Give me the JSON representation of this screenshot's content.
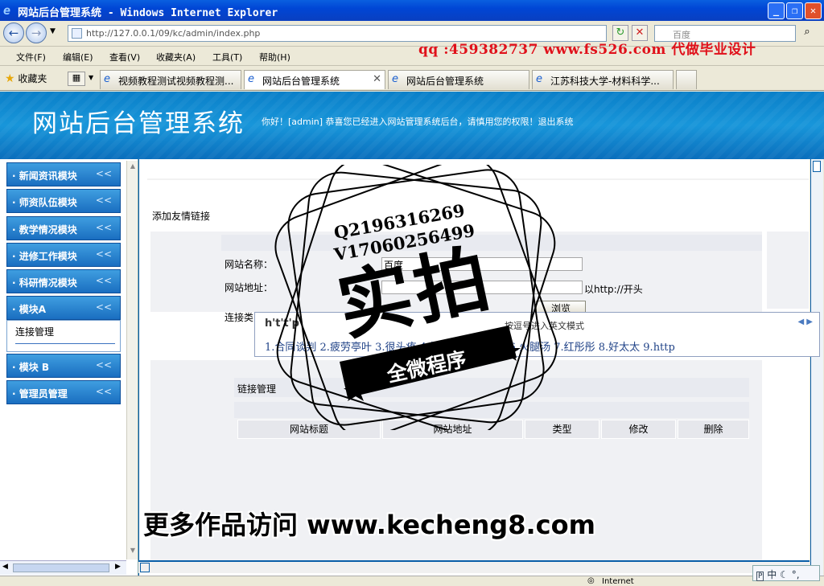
{
  "window": {
    "title": "网站后台管理系统 - Windows Internet Explorer",
    "minimize": "_",
    "maximize": "❐",
    "close": "✕"
  },
  "address_bar": {
    "url": "http://127.0.0.1/09/kc/admin/index.php",
    "search_placeholder": "百度",
    "promo": "qq :459382737 www.fs526.com 代做毕业设计"
  },
  "menu": [
    "文件(F)",
    "编辑(E)",
    "查看(V)",
    "收藏夹(A)",
    "工具(T)",
    "帮助(H)"
  ],
  "favorites_label": "收藏夹",
  "tabs": [
    {
      "label": "视频教程测试视频教程测...",
      "active": false
    },
    {
      "label": "网站后台管理系统",
      "active": true
    },
    {
      "label": "网站后台管理系统",
      "active": false
    },
    {
      "label": "江苏科技大学-材料科学...",
      "active": false
    }
  ],
  "header": {
    "site_title": "网站后台管理系统",
    "welcome": "你好！[admin] 恭喜您已经进入网站管理系统后台，请慎用您的权限！退出系统"
  },
  "sidebar": {
    "modules": [
      "· 新闻资讯模块",
      "· 师资队伍模块",
      "· 教学情况模块",
      "· 进修工作模块",
      "· 科研情况模块",
      "· 模块A",
      "· 模块 B",
      "· 管理员管理"
    ],
    "sub_item": "连接管理",
    "chevron": "<<"
  },
  "form": {
    "section_title": "添加友情链接",
    "name_label": "网站名称：",
    "name_value": "百度",
    "url_label": "网站地址：",
    "url_value": "",
    "url_hint": "以http://开头",
    "type_label": "连接类",
    "browse_button": "浏览"
  },
  "links_table": {
    "title": "链接管理",
    "headers": [
      "网站标题",
      "网站地址",
      "类型",
      "修改",
      "删除"
    ]
  },
  "ime": {
    "pinyin": "h't't'p",
    "hint": "按逗号进入英文模式",
    "candidates": "1.合同谈判 2.疲劳亭叶 3.很头疼 4.好烦恼 5.和他谈 6.火腿汤 7.红彤彤 8.好太太 9.http",
    "strip": "中"
  },
  "watermark": {
    "qq": "Q2196316269",
    "v": "V17060256499",
    "big": "实拍",
    "banner": "全微程序",
    "bottom": "更多作品访问 www.kecheng8.com"
  },
  "status": {
    "zone": "Internet"
  },
  "colors": {
    "header_blue": "#1896da",
    "module_blue": "#1a6ec0",
    "promo_red": "#e0101a"
  }
}
